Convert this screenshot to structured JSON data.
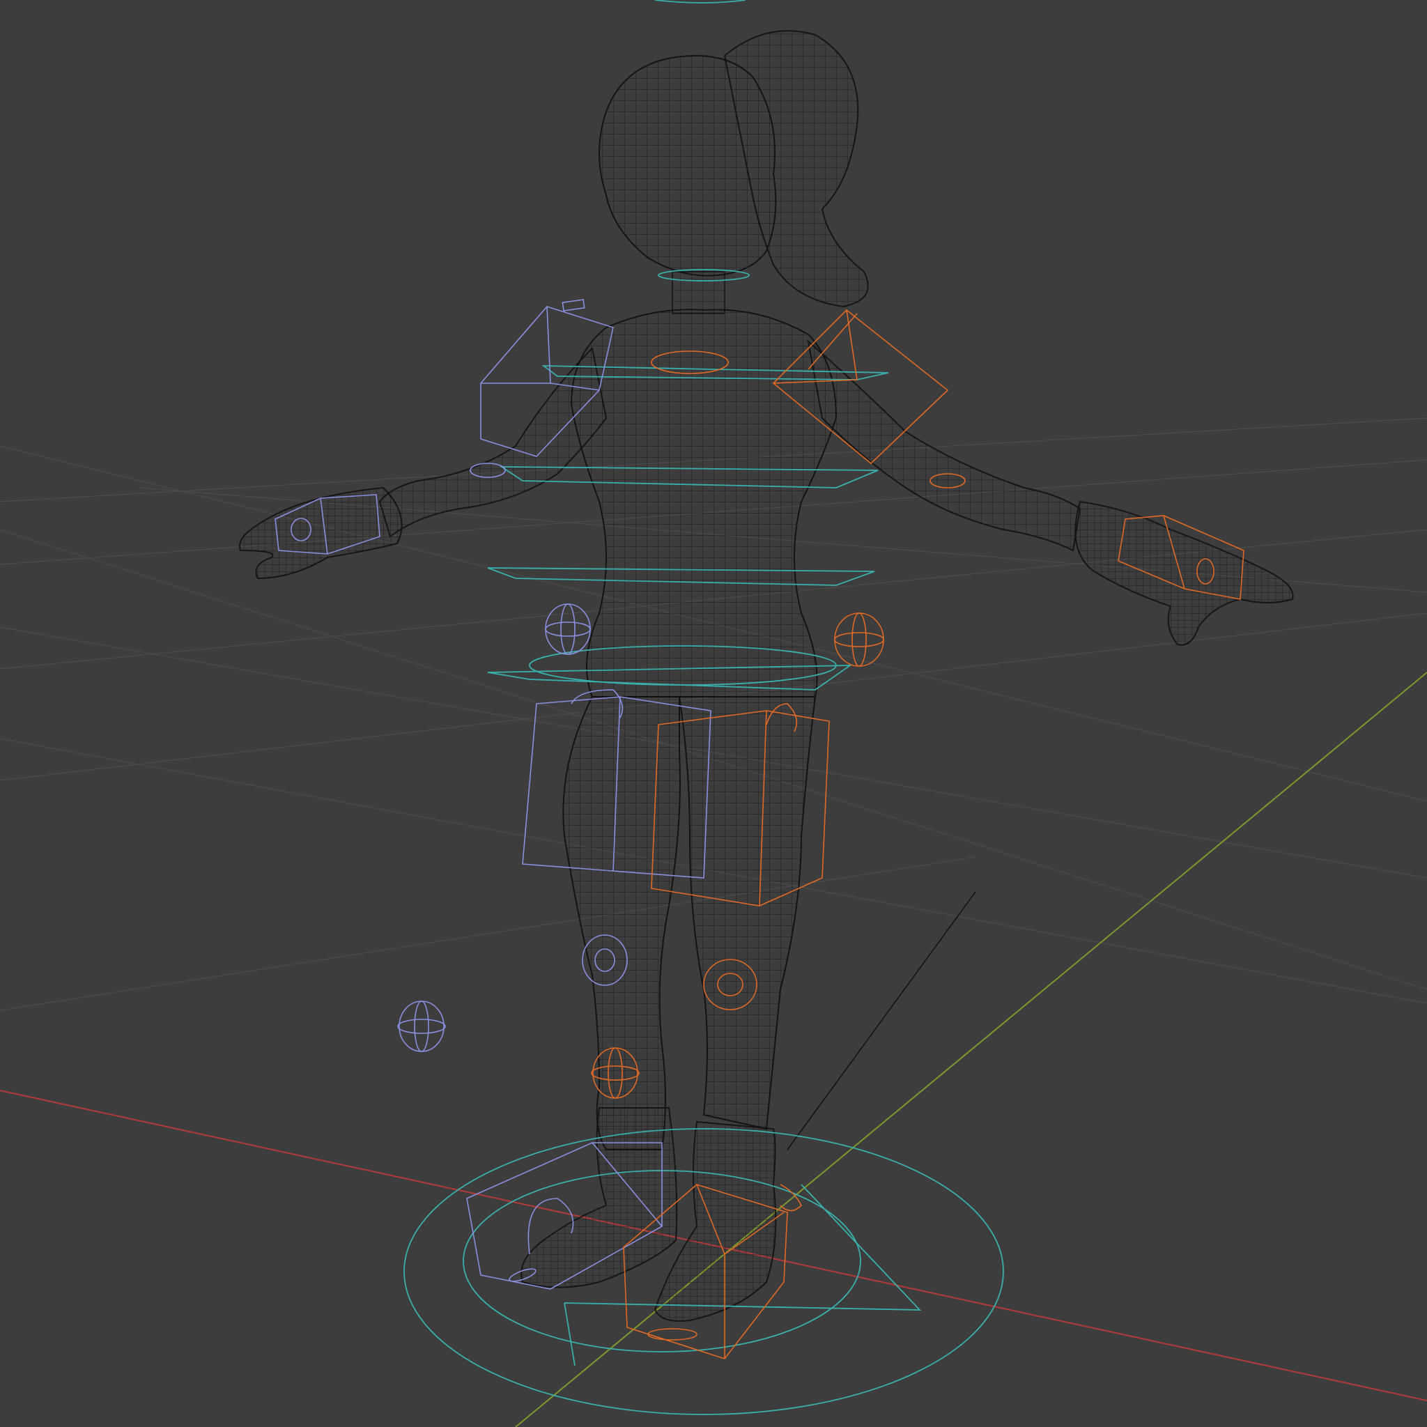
{
  "viewport": {
    "shading_mode": "wireframe",
    "background_color": "#3d3d3d",
    "grid_color": "#4a4a4a",
    "axis_x_color": "#b23a3a",
    "axis_y_color": "#7c9a2e",
    "mesh_color": "#111111",
    "left_controls_color": "#8a8fe0",
    "right_controls_color": "#e06a25",
    "center_controls_color": "#3ab0ad"
  },
  "scene": {
    "objects": [
      {
        "name": "character-mesh",
        "type": "wireframe-mesh"
      },
      {
        "name": "rig-controls-left",
        "type": "bone-shapes"
      },
      {
        "name": "rig-controls-right",
        "type": "bone-shapes"
      },
      {
        "name": "rig-controls-center",
        "type": "bone-shapes"
      }
    ]
  }
}
